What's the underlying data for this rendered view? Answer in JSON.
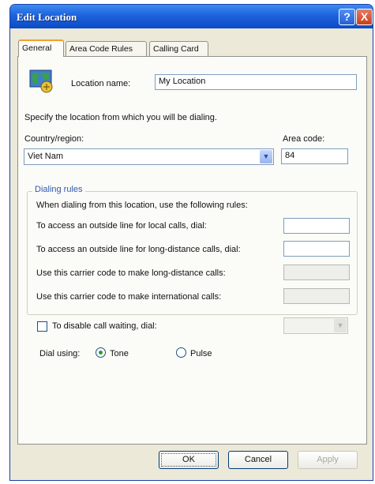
{
  "window": {
    "title": "Edit Location"
  },
  "title_buttons": {
    "help": "?",
    "close": "X"
  },
  "tabs": [
    {
      "label": "General",
      "active": true
    },
    {
      "label": "Area Code Rules",
      "active": false
    },
    {
      "label": "Calling Card",
      "active": false
    }
  ],
  "location": {
    "name_label": "Location name:",
    "name_value": "My Location"
  },
  "instructions": "Specify the location from which you will be dialing.",
  "country": {
    "label": "Country/region:",
    "value": "Viet Nam"
  },
  "area_code": {
    "label": "Area code:",
    "value": "84"
  },
  "dialing_rules": {
    "legend": "Dialing rules",
    "intro": "When dialing from this location, use the following rules:",
    "local_label": "To access an outside line for local calls, dial:",
    "local_value": "",
    "long_distance_label": "To access an outside line for long-distance calls, dial:",
    "long_distance_value": "",
    "carrier_long_label": "Use this carrier code to make long-distance calls:",
    "carrier_long_value": "",
    "carrier_intl_label": "Use this carrier code to make international calls:",
    "carrier_intl_value": ""
  },
  "call_waiting": {
    "label": "To disable call waiting, dial:",
    "checked": false,
    "value": ""
  },
  "dial_using": {
    "label": "Dial using:",
    "tone_label": "Tone",
    "pulse_label": "Pulse",
    "selected": "Tone"
  },
  "buttons": {
    "ok": "OK",
    "cancel": "Cancel",
    "apply": "Apply"
  },
  "colors": {
    "titlebar": "#0b4ac7",
    "accent_tab": "#f0a030",
    "dialog_bg": "#ECE9D8"
  }
}
